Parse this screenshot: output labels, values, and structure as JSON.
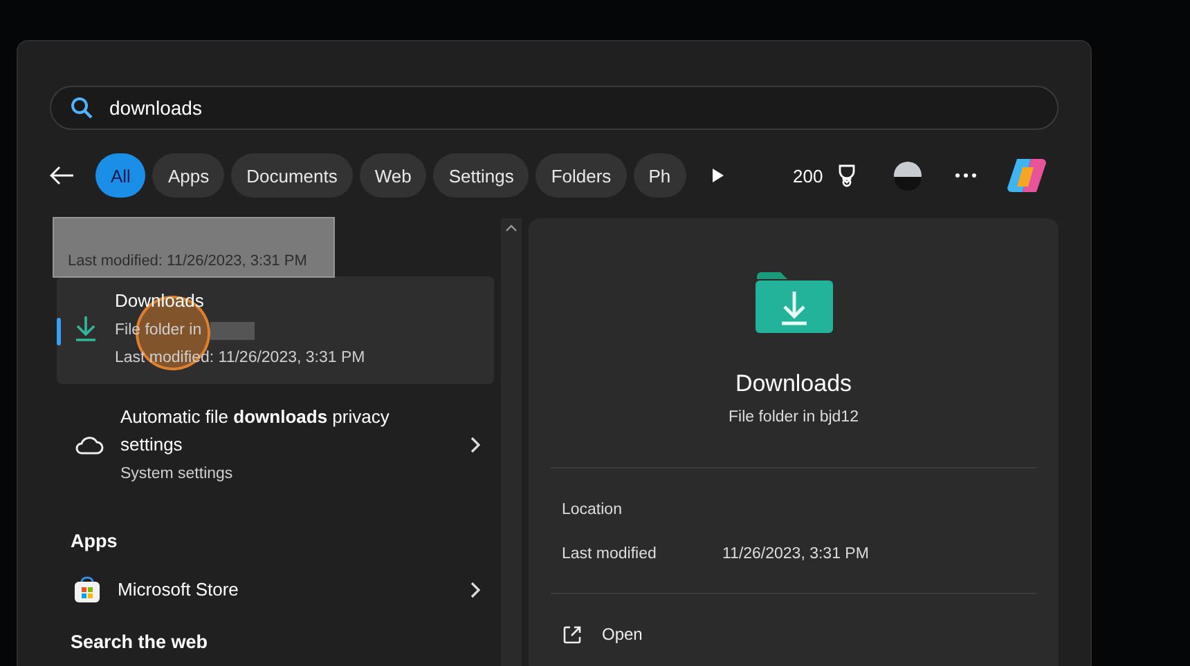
{
  "search": {
    "value": "downloads"
  },
  "filters": [
    {
      "label": "All",
      "selected": true
    },
    {
      "label": "Apps",
      "selected": false
    },
    {
      "label": "Documents",
      "selected": false
    },
    {
      "label": "Web",
      "selected": false
    },
    {
      "label": "Settings",
      "selected": false
    },
    {
      "label": "Folders",
      "selected": false
    },
    {
      "label": "Ph",
      "selected": false
    }
  ],
  "points": "200",
  "results": [
    {
      "kind": "folder",
      "title": "Downloads",
      "subtitle": "File folder in",
      "detail": "Last modified: 11/26/2023, 3:31 PM",
      "selected": true
    },
    {
      "kind": "setting",
      "title": "Automatic file **downloads** privacy settings",
      "subtitle": "System settings",
      "selected": false
    },
    {
      "kind": "heading",
      "title": "Apps"
    },
    {
      "kind": "app",
      "title": "Microsoft Store",
      "selected": false
    },
    {
      "kind": "heading",
      "title": "Search the web"
    }
  ],
  "drag_ghost": {
    "text": "Last modified: 11/26/2023, 3:31 PM"
  },
  "preview": {
    "title": "Downloads",
    "subtitle": "File folder in bjd12",
    "details": [
      {
        "label": "Location"
      },
      {
        "label": "Last modified",
        "value": "11/26/2023, 3:31 PM"
      }
    ],
    "actions": [
      {
        "label": "Open"
      }
    ]
  }
}
